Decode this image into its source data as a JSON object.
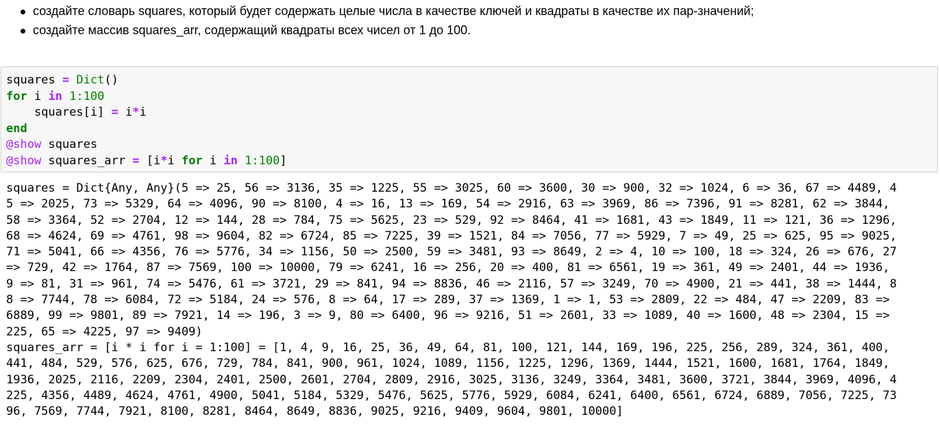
{
  "markdown": {
    "bullets": [
      "создайте словарь squares, который будет содержать целые числа в качестве ключей и квадраты в качестве их пар-значений;",
      "создайте массив squares_arr, содержащий квадраты всех чисел от 1 до 100."
    ]
  },
  "code": {
    "l1": {
      "a": "squares ",
      "b": "=",
      "c": " ",
      "d": "Dict",
      "e": "()"
    },
    "l2": {
      "a": "for",
      "b": " i ",
      "c": "in",
      "d": " ",
      "e": "1",
      "f": ":",
      "g": "100"
    },
    "l3": {
      "a": "    squares[i] ",
      "b": "=",
      "c": " i",
      "d": "*",
      "e": "i"
    },
    "l4": {
      "a": "end"
    },
    "l5": {
      "a": "@show",
      "b": " squares"
    },
    "l6": {
      "a": "@show",
      "b": " squares_arr ",
      "c": "=",
      "d": " [i",
      "e": "*",
      "f": "i ",
      "g": "for",
      "h": " i ",
      "i": "in",
      "j": " ",
      "k": "1",
      "l": ":",
      "m": "100",
      "n": "]"
    }
  },
  "output": {
    "lines": [
      "squares = Dict{Any, Any}(5 => 25, 56 => 3136, 35 => 1225, 55 => 3025, 60 => 3600, 30 => 900, 32 => 1024, 6 => 36, 67 => 4489, 4",
      "5 => 2025, 73 => 5329, 64 => 4096, 90 => 8100, 4 => 16, 13 => 169, 54 => 2916, 63 => 3969, 86 => 7396, 91 => 8281, 62 => 3844,",
      "58 => 3364, 52 => 2704, 12 => 144, 28 => 784, 75 => 5625, 23 => 529, 92 => 8464, 41 => 1681, 43 => 1849, 11 => 121, 36 => 1296,",
      "68 => 4624, 69 => 4761, 98 => 9604, 82 => 6724, 85 => 7225, 39 => 1521, 84 => 7056, 77 => 5929, 7 => 49, 25 => 625, 95 => 9025,",
      "71 => 5041, 66 => 4356, 76 => 5776, 34 => 1156, 50 => 2500, 59 => 3481, 93 => 8649, 2 => 4, 10 => 100, 18 => 324, 26 => 676, 27",
      "=> 729, 42 => 1764, 87 => 7569, 100 => 10000, 79 => 6241, 16 => 256, 20 => 400, 81 => 6561, 19 => 361, 49 => 2401, 44 => 1936,",
      "9 => 81, 31 => 961, 74 => 5476, 61 => 3721, 29 => 841, 94 => 8836, 46 => 2116, 57 => 3249, 70 => 4900, 21 => 441, 38 => 1444, 8",
      "8 => 7744, 78 => 6084, 72 => 5184, 24 => 576, 8 => 64, 17 => 289, 37 => 1369, 1 => 1, 53 => 2809, 22 => 484, 47 => 2209, 83 =>",
      "6889, 99 => 9801, 89 => 7921, 14 => 196, 3 => 9, 80 => 6400, 96 => 9216, 51 => 2601, 33 => 1089, 40 => 1600, 48 => 2304, 15 =>",
      "225, 65 => 4225, 97 => 9409)",
      "squares_arr = [i * i for i = 1:100] = [1, 4, 9, 16, 25, 36, 49, 64, 81, 100, 121, 144, 169, 196, 225, 256, 289, 324, 361, 400,",
      "441, 484, 529, 576, 625, 676, 729, 784, 841, 900, 961, 1024, 1089, 1156, 1225, 1296, 1369, 1444, 1521, 1600, 1681, 1764, 1849,",
      "1936, 2025, 2116, 2209, 2304, 2401, 2500, 2601, 2704, 2809, 2916, 3025, 3136, 3249, 3364, 3481, 3600, 3721, 3844, 3969, 4096, 4",
      "225, 4356, 4489, 4624, 4761, 4900, 5041, 5184, 5329, 5476, 5625, 5776, 5929, 6084, 6241, 6400, 6561, 6724, 6889, 7056, 7225, 73",
      "96, 7569, 7744, 7921, 8100, 8281, 8464, 8649, 8836, 9025, 9216, 9409, 9604, 9801, 10000]"
    ]
  }
}
